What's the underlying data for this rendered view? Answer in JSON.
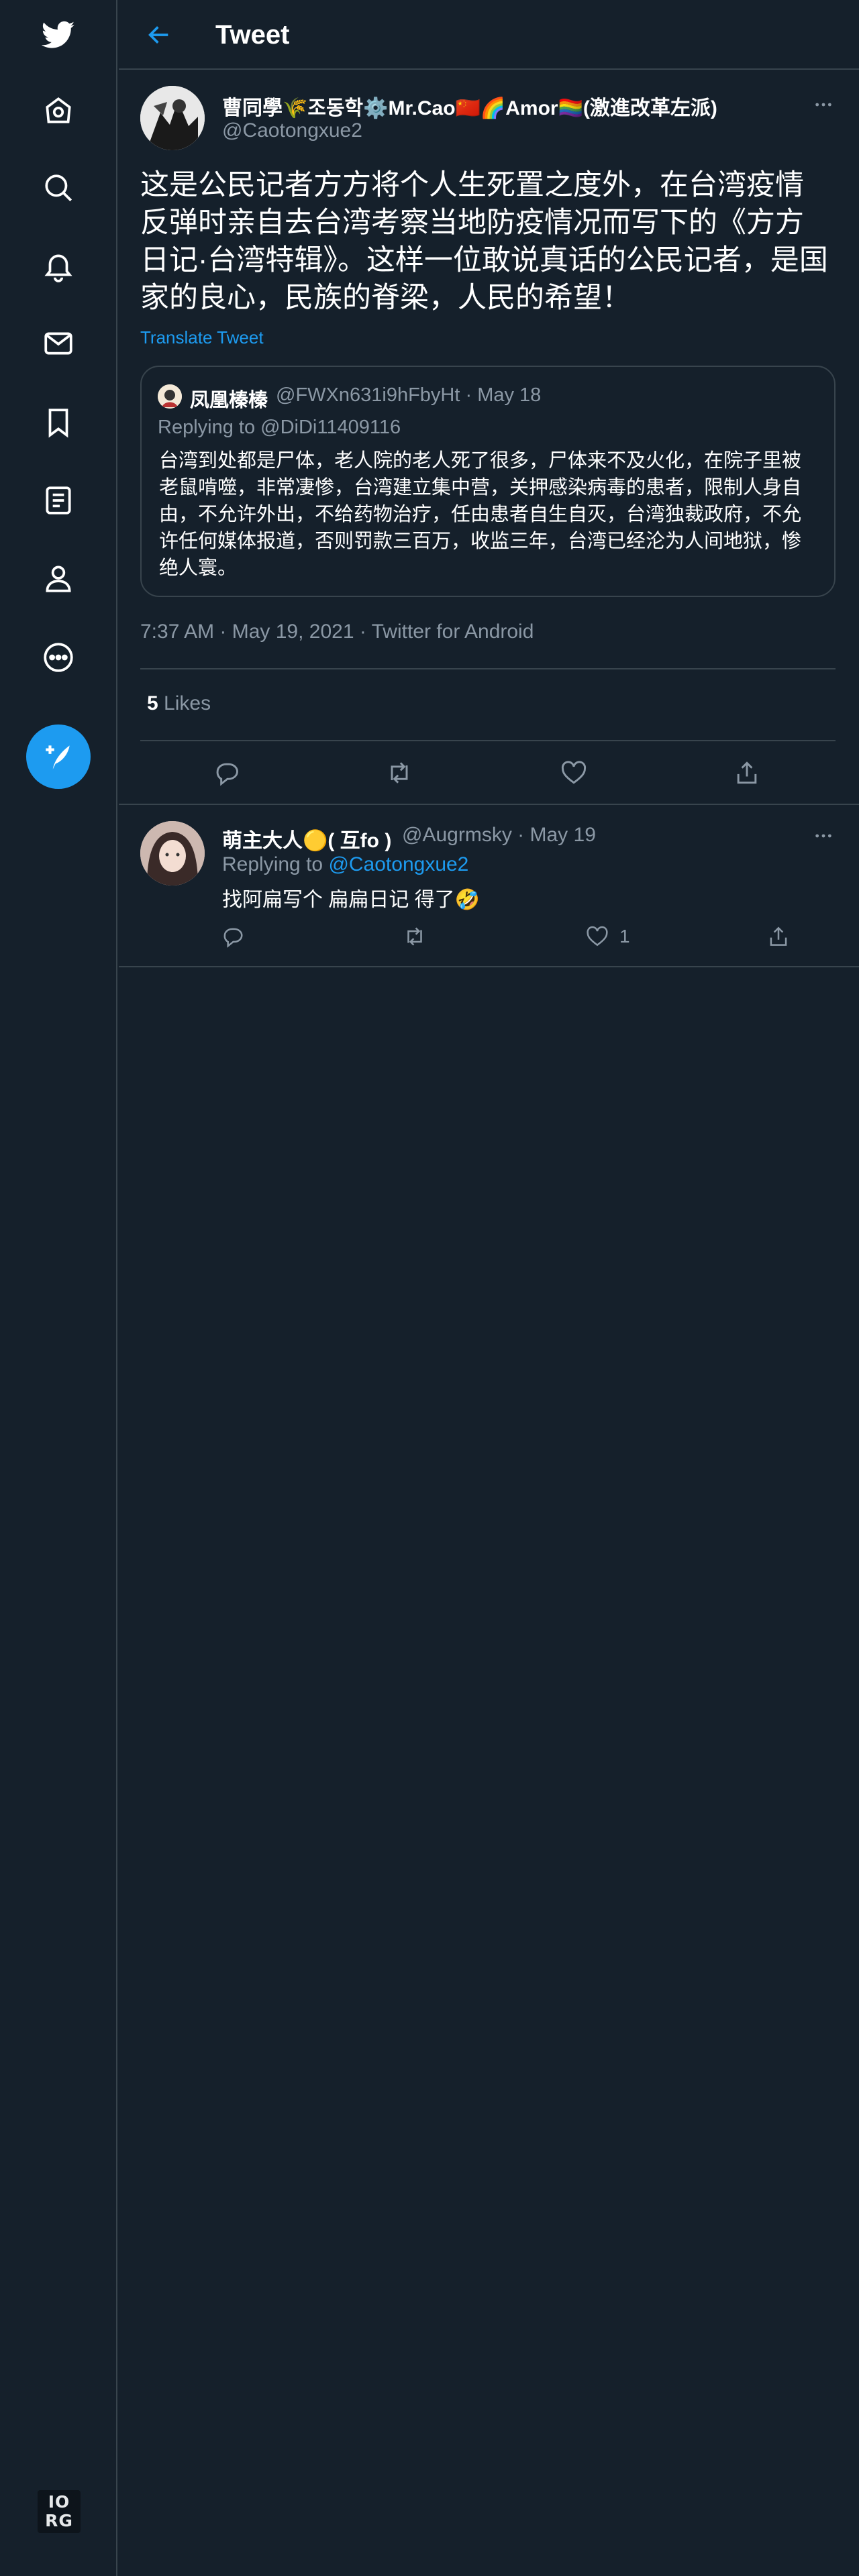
{
  "nav": {
    "items": [
      {
        "name": "twitter-logo-icon"
      },
      {
        "name": "home-icon"
      },
      {
        "name": "explore-icon"
      },
      {
        "name": "notifications-icon"
      },
      {
        "name": "messages-icon"
      },
      {
        "name": "bookmarks-icon"
      },
      {
        "name": "lists-icon"
      },
      {
        "name": "profile-icon"
      },
      {
        "name": "more-icon"
      }
    ],
    "badge_line1": "IO",
    "badge_line2": "RG"
  },
  "header": {
    "title": "Tweet"
  },
  "tweet": {
    "author_name": "曹同學🌾조동학⚙️Mr.Cao🇨🇳🌈Amor🏳️‍🌈(激進改革左派)",
    "author_handle": "@Caotongxue2",
    "text": "这是公民记者方方将个人生死置之度外，在台湾疫情反弹时亲自去台湾考察当地防疫情况而写下的《方方日记·台湾特辑》。这样一位敢说真话的公民记者，是国家的良心，民族的脊梁，人民的希望！",
    "translate_label": "Translate Tweet",
    "timestamp": "7:37 AM · May 19, 2021 · Twitter for Android",
    "likes_count": "5",
    "likes_label": "Likes"
  },
  "quote": {
    "author_name": "凤凰榛榛",
    "author_handle": "@FWXn631i9hFbyHt",
    "date": "· May 18",
    "replying_label": "Replying to",
    "replying_to": "@DiDi11409116",
    "text": "台湾到处都是尸体，老人院的老人死了很多，尸体来不及火化，在院子里被老鼠啃噬，非常凄惨，台湾建立集中营，关押感染病毒的患者，限制人身自由，不允许外出，不给药物治疗，任由患者自生自灭，台湾独裁政府，不允许任何媒体报道，否则罚款三百万，收监三年，台湾已经沦为人间地狱，惨绝人寰。"
  },
  "reply": {
    "author_name": "萌主大人🟡( 互fo )",
    "author_handle": "@Augrmsky",
    "date": "· May 19",
    "replying_label": "Replying to",
    "replying_to": "@Caotongxue2",
    "text": "找阿扁写个 扁扁日记 得了🤣",
    "like_count": "1"
  },
  "colors": {
    "background": "#15202b",
    "border": "#38444d",
    "accent": "#1d9bf0",
    "muted": "#8b98a5"
  }
}
